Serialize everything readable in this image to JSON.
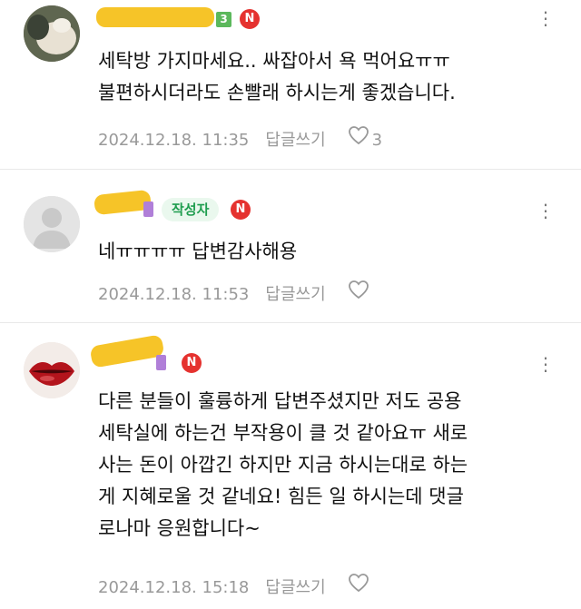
{
  "comments": [
    {
      "level": "3",
      "badge_new": "N",
      "author_tag": "",
      "text": "세탁방 가지마세요.. 싸잡아서 욕 먹어요ㅠㅠ\n불편하시더라도 손빨래 하시는게 좋겠습니다.",
      "date": "2024.12.18. 11:35",
      "reply_label": "답글쓰기",
      "likes": "3",
      "more_label": "⋮",
      "colors": {
        "level": "#5cb85c"
      }
    },
    {
      "level": "",
      "badge_new": "N",
      "author_tag": "작성자",
      "text": "네ㅠㅠㅠㅠ 답변감사해용",
      "date": "2024.12.18. 11:53",
      "reply_label": "답글쓰기",
      "likes": "",
      "more_label": "⋮"
    },
    {
      "level": "",
      "badge_new": "N",
      "author_tag": "",
      "text": "다른 분들이 훌륭하게 답변주셨지만 저도 공용\n세탁실에 하는건 부작용이 클 것 같아요ㅠ 새로\n사는 돈이 아깝긴 하지만 지금 하시는대로 하는\n게 지혜로울 것 같네요! 힘든 일 하시는데 댓글\n로나마 응원합니다~",
      "date": "2024.12.18. 15:18",
      "reply_label": "답글쓰기",
      "likes": "",
      "more_label": "⋮"
    }
  ],
  "colors": {
    "badge_new": "#e5322f",
    "author_tag_bg": "#eaf8ee",
    "author_tag_text": "#1f9d4f",
    "level_purple": "#b07fd8",
    "meta_text": "#999999",
    "redaction": "#f6c428"
  }
}
